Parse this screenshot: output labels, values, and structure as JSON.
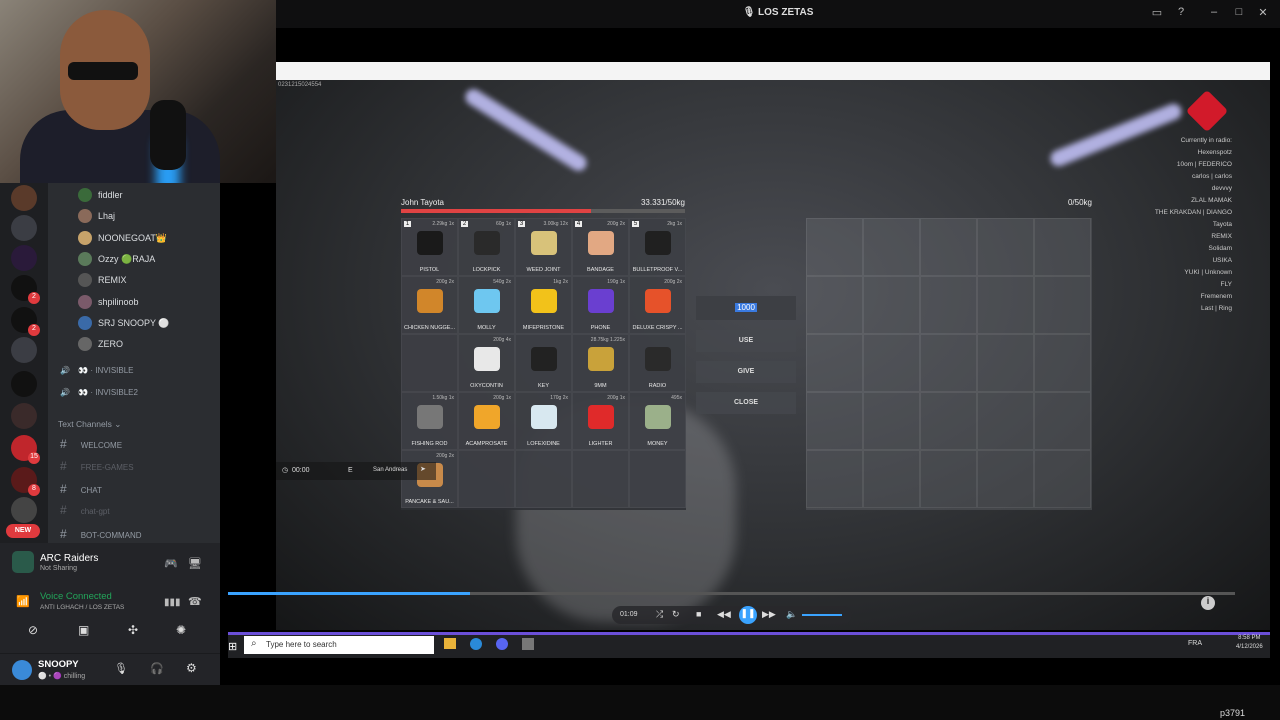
{
  "window": {
    "title": "LOS ZETAS"
  },
  "stream": {
    "debug_line": "0231215024554",
    "player_list": [
      "Currently in radio:",
      "Hexenspotz",
      "10om | FEDERICO",
      "carlos | carlos",
      "devvvy",
      "ZLAL MAMAK",
      "THE KRAKDAN | DIANGO",
      "Tayota",
      "REMIX",
      "Solidam",
      "USIKA",
      "YUKI | Unknown",
      "FLY",
      "Fremenem",
      "Last | Ring"
    ]
  },
  "inventory": {
    "owner": "John Tayota",
    "weight": "33.331/50kg",
    "weight_fraction": 0.67,
    "items": [
      {
        "num": "1",
        "meta": "2.29kg 1x",
        "label": "PISTOL",
        "color": "#1a1a1a"
      },
      {
        "num": "2",
        "meta": "60g 1x",
        "label": "LOCKPICK",
        "color": "#2a2a2a"
      },
      {
        "num": "3",
        "meta": "3.00kg 12x",
        "label": "WEED JOINT",
        "color": "#d8c27a"
      },
      {
        "num": "4",
        "meta": "200g 2x",
        "label": "BANDAGE",
        "color": "#e2a883"
      },
      {
        "num": "5",
        "meta": "2kg 1x",
        "label": "BULLETPROOF V...",
        "color": "#202020"
      },
      {
        "num": "",
        "meta": "200g 2x",
        "label": "CHICKEN NUGGE...",
        "color": "#d1862a"
      },
      {
        "num": "",
        "meta": "540g 2x",
        "label": "MOLLY",
        "color": "#6ec7f0"
      },
      {
        "num": "",
        "meta": "1kg 2x",
        "label": "MIFEPRISTONE",
        "color": "#f2c21a"
      },
      {
        "num": "",
        "meta": "190g 1x",
        "label": "PHONE",
        "color": "#6a3fd0"
      },
      {
        "num": "",
        "meta": "200g 2x",
        "label": "DELUXE CRISPY ...",
        "color": "#e6522a"
      },
      {
        "num": "",
        "meta": "",
        "label": "",
        "color": ""
      },
      {
        "num": "",
        "meta": "200g 4x",
        "label": "OXYCONTIN",
        "color": "#e8e8e8"
      },
      {
        "num": "",
        "meta": "",
        "label": "KEY",
        "color": "#222222"
      },
      {
        "num": "",
        "meta": "28.75kg 1.225x",
        "label": "9MM",
        "color": "#c9a23a"
      },
      {
        "num": "",
        "meta": "",
        "label": "RADIO",
        "color": "#2a2a2a"
      },
      {
        "num": "",
        "meta": "1.50kg 1x",
        "label": "FISHING ROD",
        "color": "#777777"
      },
      {
        "num": "",
        "meta": "200g 1x",
        "label": "ACAMPROSATE",
        "color": "#f0a62a"
      },
      {
        "num": "",
        "meta": "170g 2x",
        "label": "LOFEXIDINE",
        "color": "#d8e8f0"
      },
      {
        "num": "",
        "meta": "200g 1x",
        "label": "LIGHTER",
        "color": "#e02a2a"
      },
      {
        "num": "",
        "meta": "495x",
        "label": "MONEY",
        "color": "#9bb08a"
      },
      {
        "num": "",
        "meta": "200g 2x",
        "label": "PANCAKE & SAU...",
        "color": "#c88a4a"
      },
      {
        "num": "",
        "meta": "",
        "label": "",
        "color": ""
      },
      {
        "num": "",
        "meta": "",
        "label": "",
        "color": ""
      },
      {
        "num": "",
        "meta": "",
        "label": "",
        "color": ""
      },
      {
        "num": "",
        "meta": "",
        "label": "",
        "color": ""
      }
    ],
    "amount_value": "1000",
    "actions": [
      "USE",
      "GIVE",
      "CLOSE"
    ],
    "other_weight": "0/50kg"
  },
  "hud": {
    "time": "00:00",
    "direction": "E",
    "location": "San Andreas"
  },
  "player": {
    "progress": 0.24,
    "elapsed": "01:09"
  },
  "taskbar": {
    "search_placeholder": "Type here to search",
    "time": "8:58 PM",
    "date": "4/12/2026",
    "lang": "FRA"
  },
  "discord": {
    "voice_users": [
      {
        "name": "fiddler"
      },
      {
        "name": "Lhaj"
      },
      {
        "name": "NOONEGOAT👑"
      },
      {
        "name": "Ozzy 🟢RAJA"
      },
      {
        "name": "REMIX"
      },
      {
        "name": "shpilinoob"
      },
      {
        "name": "SRJ SNOOPY ⚪"
      },
      {
        "name": "ZERO"
      }
    ],
    "voice_channels": [
      "INVISIBLE",
      "INVISIBLE2"
    ],
    "text_header": "Text Channels",
    "text_channels": [
      "WELCOME",
      "FREE-GAMES",
      "CHAT",
      "chat-gpt",
      "BOT-COMMAND"
    ],
    "server_badges": [
      "2",
      "2",
      "15",
      "8"
    ],
    "new_label": "NEW",
    "activity": {
      "title": "ARC Raiders",
      "subtitle": "Not Sharing"
    },
    "voice_status": {
      "title": "Voice Connected",
      "subtitle": "ANTI LGHACH / LOS ZETAS"
    },
    "me": {
      "name": "SNOOPY",
      "status": "chilling"
    }
  },
  "viewer_id": "p3791"
}
